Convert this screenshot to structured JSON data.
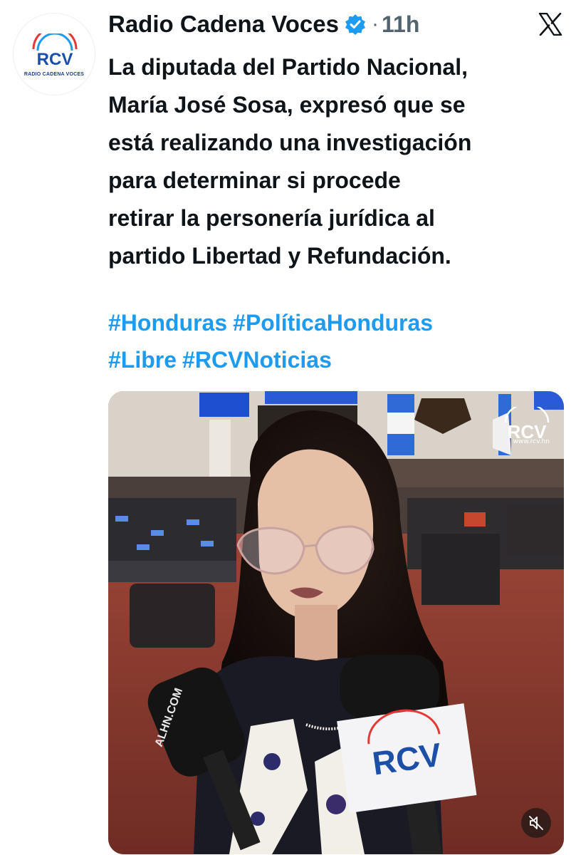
{
  "account": {
    "name": "Radio Cadena Voces",
    "verified": true,
    "separator": "·",
    "time": "11h",
    "avatar_icon": "rcv-logo",
    "avatar_logo_text": "RCV",
    "avatar_caption": "RADIO CADENA VOCES"
  },
  "platform_icon": "x-logo",
  "post": {
    "text": "La diputada del Partido Nacional,\nMaría José Sosa, expresó que se\nestá realizando una investigación\npara determinar si procede\nretirar la personería jurídica al\npartido Libertad y Refundación.",
    "hashtags": [
      "#Honduras",
      "#PolíticaHonduras",
      "#Libre",
      "#RCVNoticias"
    ]
  },
  "media": {
    "type": "video",
    "watermark_logo": "RCV",
    "watermark_url": "www.rcv.hn",
    "mute_icon": "speaker-muted-icon",
    "colors": {
      "carpet": "#8a3b30",
      "accent": "#1d9bf0",
      "brand_blue": "#1b4fa8"
    }
  }
}
